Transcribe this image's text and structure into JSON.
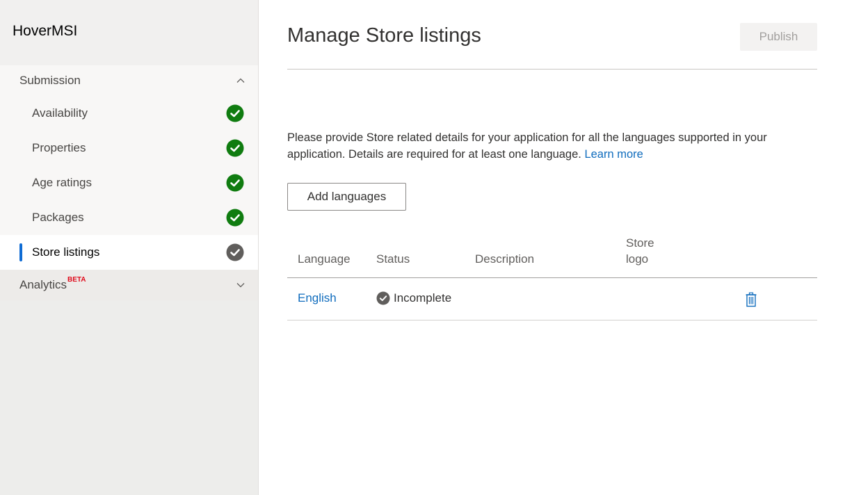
{
  "app": {
    "name": "HoverMSI"
  },
  "sidebar": {
    "sections": [
      {
        "label": "Submission",
        "expanded": true,
        "chevron": "chevron-up-icon",
        "items": [
          {
            "label": "Availability",
            "status": "complete",
            "icon": "check-circle-icon"
          },
          {
            "label": "Properties",
            "status": "complete",
            "icon": "check-circle-icon"
          },
          {
            "label": "Age ratings",
            "status": "complete",
            "icon": "check-circle-icon"
          },
          {
            "label": "Packages",
            "status": "complete",
            "icon": "check-circle-icon"
          },
          {
            "label": "Store listings",
            "status": "incomplete",
            "icon": "check-circle-icon",
            "active": true
          }
        ]
      },
      {
        "label": "Analytics",
        "badge": "BETA",
        "expanded": false,
        "chevron": "chevron-down-icon"
      }
    ]
  },
  "main": {
    "title": "Manage Store listings",
    "publish_label": "Publish",
    "intro_text": "Please provide Store related details for your application for all the languages supported in your application. Details are required for at least one language. ",
    "learn_more": "Learn more",
    "add_languages_label": "Add languages",
    "table": {
      "headers": {
        "language": "Language",
        "status": "Status",
        "description": "Description",
        "store_logo_line1": "Store",
        "store_logo_line2": "logo"
      },
      "rows": [
        {
          "language": "English",
          "status": "Incomplete",
          "description": "",
          "store_logo": "",
          "action_icon": "trash-icon"
        }
      ]
    }
  },
  "colors": {
    "complete": "#107c10",
    "incomplete": "#605e5c",
    "accent": "#0f6cbd",
    "active_indicator": "#0f6cd4",
    "beta": "#e00b1c"
  }
}
